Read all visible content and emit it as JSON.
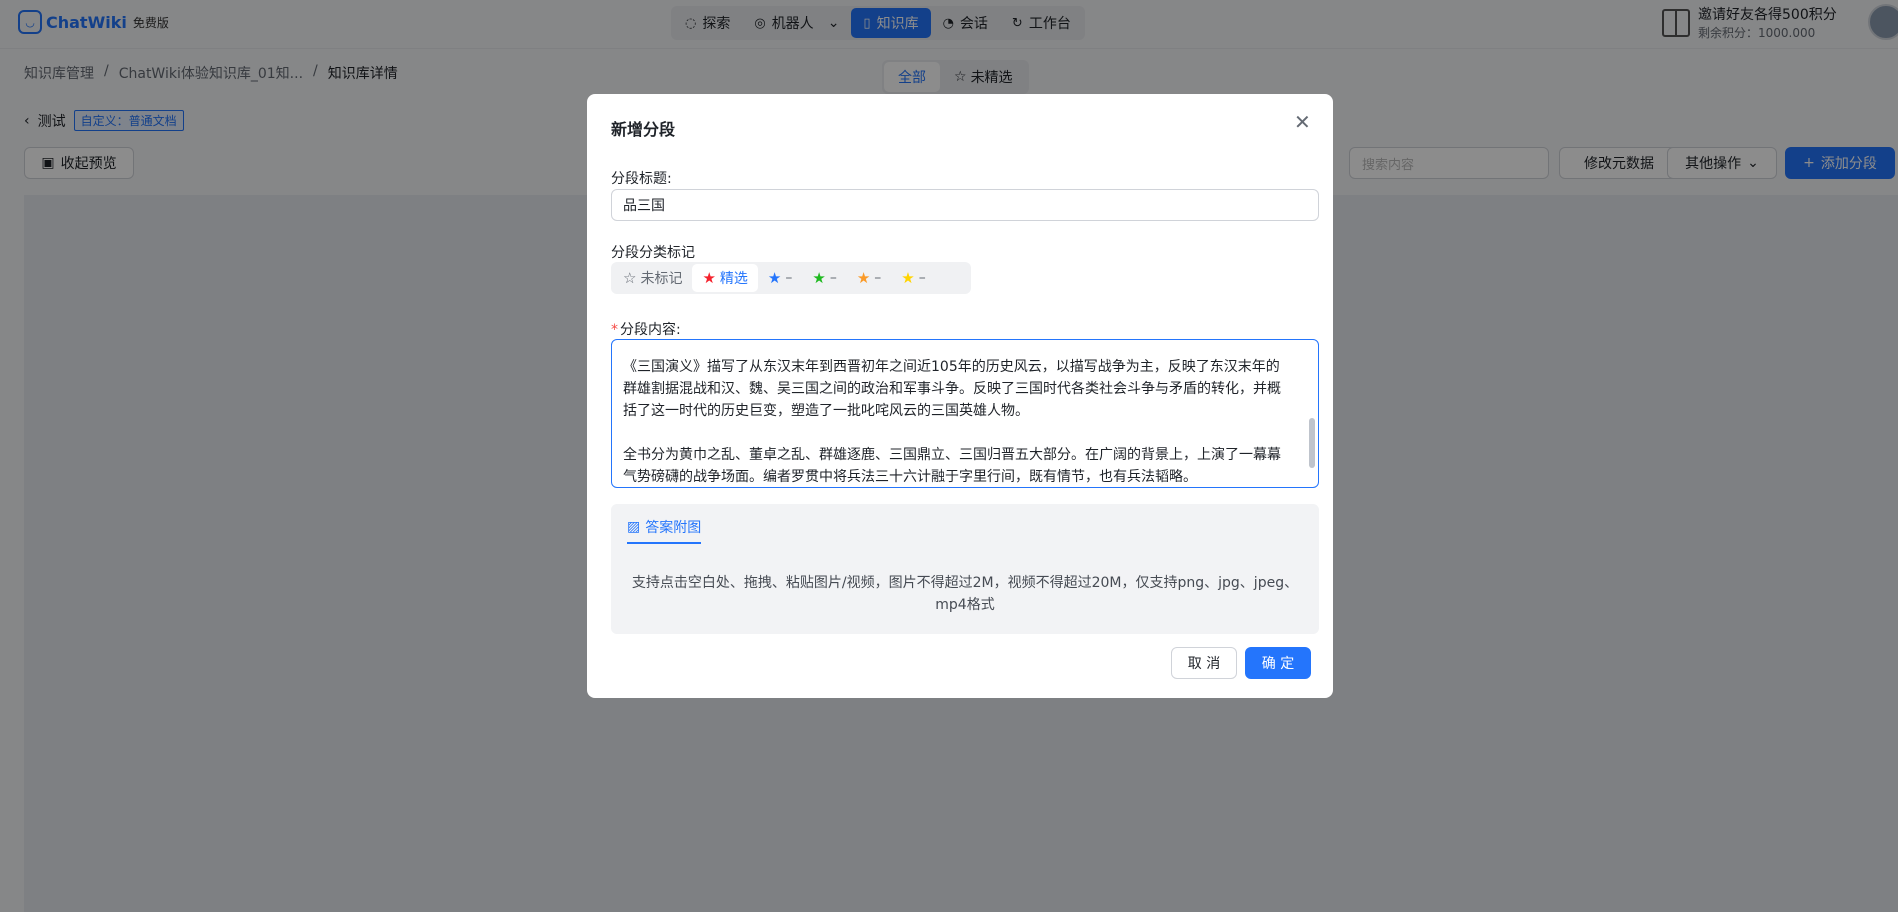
{
  "app": {
    "name": "ChatWiki",
    "version_badge": "免费版"
  },
  "nav": {
    "items": [
      {
        "label": "探索",
        "icon": "explore-icon",
        "active": false
      },
      {
        "label": "机器人",
        "icon": "robot-icon",
        "active": false
      },
      {
        "label": "知识库",
        "icon": "book-icon",
        "active": true
      },
      {
        "label": "会话",
        "icon": "chat-icon",
        "active": false
      },
      {
        "label": "工作台",
        "icon": "workbench-icon",
        "active": false
      }
    ]
  },
  "invite": {
    "title": "邀请好友各得500积分",
    "points": "剩余积分：1000.000"
  },
  "breadcrumb": [
    "知识库管理",
    "/",
    "ChatWiki体验知识库_01知...",
    "/",
    "知识库详情"
  ],
  "filter_tabs": {
    "all": "全部",
    "unselected": "未精选"
  },
  "doc": {
    "back_label": "测试",
    "tag": "自定义：普通文档"
  },
  "toolbar": {
    "collapse": "收起预览",
    "search_placeholder": "搜索内容",
    "edit_meta": "修改元数据",
    "other": "其他操作",
    "add": "添加分段"
  },
  "modal": {
    "title": "新增分段",
    "segment_title_label": "分段标题:",
    "segment_title_value": "品三国",
    "mark_label": "分段分类标记",
    "marks": [
      {
        "label": "未标记",
        "color": "#646a73",
        "active": false
      },
      {
        "label": "精选",
        "color": "#f5222d",
        "active": true
      },
      {
        "label": "–",
        "color": "#2475fc",
        "active": false
      },
      {
        "label": "–",
        "color": "#1fb91f",
        "active": false
      },
      {
        "label": "–",
        "color": "#fa9a28",
        "active": false
      },
      {
        "label": "–",
        "color": "#ffd400",
        "active": false
      }
    ],
    "content_label": "分段内容:",
    "content_paragraphs": [
      "《三国演义》描写了从东汉末年到西晋初年之间近105年的历史风云，以描写战争为主，反映了东汉末年的群雄割据混战和汉、魏、吴三国之间的政治和军事斗争。反映了三国时代各类社会斗争与矛盾的转化，并概括了这一时代的历史巨变，塑造了一批叱咤风云的三国英雄人物。",
      "全书分为黄巾之乱、董卓之乱、群雄逐鹿、三国鼎立、三国归晋五大部分。在广阔的背景上，上演了一幕幕气势磅礴的战争场面。编者罗贯中将兵法三十六计融于字里行间，既有情节，也有兵法韬略。"
    ],
    "attachment_tab": "答案附图",
    "attachment_hint": "支持点击空白处、拖拽、粘贴图片/视频，图片不得超过2M，视频不得超过20M，仅支持png、jpg、jpeg、mp4格式",
    "cancel": "取 消",
    "ok": "确 定"
  }
}
